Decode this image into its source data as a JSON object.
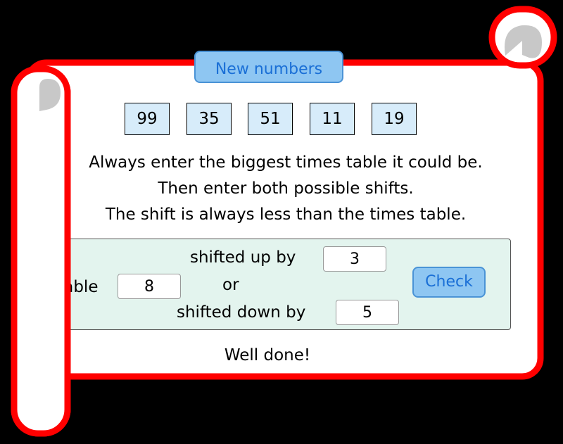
{
  "buttons": {
    "new_numbers": "New numbers",
    "check": "Check"
  },
  "numbers": [
    "99",
    "35",
    "51",
    "11",
    "19"
  ],
  "instructions": [
    "Always enter the biggest times table it could be.",
    "Then enter both possible shifts.",
    "The shift is always less than the times table."
  ],
  "form": {
    "table_label": "Table",
    "table_value": "8",
    "shifted_up_label": "shifted up by",
    "shifted_up_value": "3",
    "or_label": "or",
    "shifted_down_label": "shifted down by",
    "shifted_down_value": "5"
  },
  "feedback": "Well done!",
  "colors": {
    "scroll_border": "#ff0000",
    "button_fill": "#8ec6f2",
    "number_fill": "#d7ecfa",
    "panel_fill": "#e3f4ee"
  }
}
